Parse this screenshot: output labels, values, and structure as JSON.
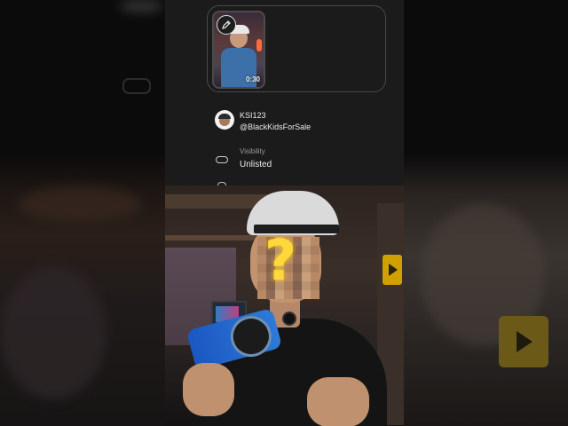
{
  "video_card": {
    "duration": "0:30",
    "edit_icon": "pencil-icon"
  },
  "channel": {
    "name": "KSI123",
    "handle": "@BlackKidsForSale"
  },
  "visibility": {
    "label": "Visibility",
    "value": "Unlisted",
    "icon": "link-icon"
  },
  "colors": {
    "panel_bg": "#1b1b1b",
    "text_primary": "#eaeaea",
    "text_secondary": "#9a9a9a",
    "overlay_question": "#ffd93b"
  }
}
